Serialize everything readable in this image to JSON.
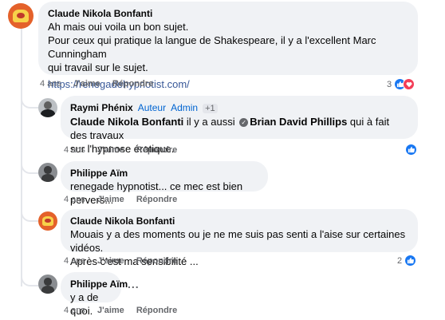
{
  "comments": [
    {
      "author": "Claude Nikola Bonfanti",
      "lines": [
        "Ah mais oui voila un bon sujet.",
        "Pour ceux qui pratique la langue de Shakespeare, il y a l'excellent Marc Cunningham",
        "qui travail sur le sujet."
      ],
      "link": "https://renegadehypnotist.com/",
      "time": "4 ans",
      "like_label": "J'aime",
      "reply_label": "Répondre",
      "reaction_count": "3"
    },
    {
      "author": "Raymi Phénix",
      "badge_author": "Auteur",
      "badge_admin": "Admin",
      "badge_count": "+1",
      "mention_author": "Claude Nikola Bonfanti",
      "text_a": " il y a aussi ",
      "mention_other": "Brian David Phillips",
      "text_b": " qui à fait des travaux",
      "line2": "sur l'hypnose érotique.",
      "time": "4 ans",
      "like_label": "J'aime",
      "reply_label": "Répondre"
    },
    {
      "author": "Philippe Aïm",
      "text": "renegade hypnotist... ce mec est bien pervers...",
      "time": "4 ans",
      "like_label": "J'aime",
      "reply_label": "Répondre"
    },
    {
      "author": "Claude Nikola Bonfanti",
      "lines": [
        "Mouais y a des moments ou je ne me suis pas senti a l'aise sur certaines vidéos.",
        "Après c'est ma sensibilité ..."
      ],
      "time": "4 ans",
      "like_label": "J'aime",
      "reply_label": "Répondre",
      "reaction_count": "2"
    },
    {
      "author": "Philippe Aïm",
      "text": "y a de quoi.",
      "more": "...",
      "time": "4 ans",
      "like_label": "J'aime",
      "reply_label": "Répondre"
    }
  ],
  "colors": {
    "bubble": "#f0f2f5",
    "like": "#1877f2",
    "love": "#f33e58",
    "meta": "#65676b"
  },
  "icons": {
    "like": "thumbs-up-icon",
    "love": "heart-icon",
    "verified": "verified-check-icon"
  }
}
